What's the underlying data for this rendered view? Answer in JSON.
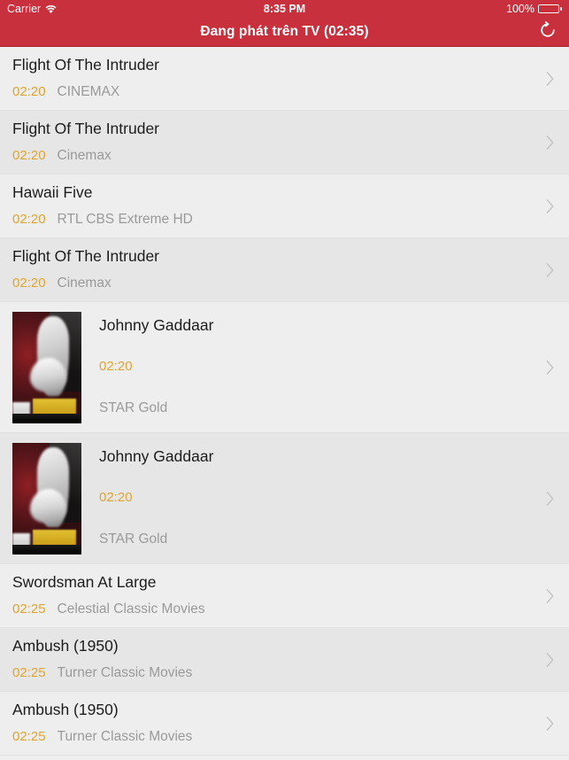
{
  "status_bar": {
    "carrier": "Carrier",
    "wifi_icon": "wifi-icon",
    "time": "8:35 PM",
    "battery_percent": "100%",
    "battery_icon": "battery-full-icon"
  },
  "nav_bar": {
    "title": "Đang phát trên TV (02:35)",
    "refresh_icon": "refresh-icon"
  },
  "colors": {
    "brand_red": "#c8303e",
    "time_amber": "#e0a430",
    "channel_gray": "#9a9a9a",
    "row_light": "#eeeeee",
    "row_dark": "#e6e6e6",
    "chevron_gray": "#c6c6c6"
  },
  "list": {
    "rows": [
      {
        "title": "Flight Of The Intruder",
        "time": "02:20",
        "channel": "CINEMAX",
        "has_thumbnail": false,
        "chevron_icon": "chevron-right-icon"
      },
      {
        "title": "Flight Of The Intruder",
        "time": "02:20",
        "channel": "Cinemax",
        "has_thumbnail": false,
        "chevron_icon": "chevron-right-icon"
      },
      {
        "title": "Hawaii Five",
        "time": "02:20",
        "channel": "RTL CBS Extreme HD",
        "has_thumbnail": false,
        "chevron_icon": "chevron-right-icon"
      },
      {
        "title": "Flight Of The Intruder",
        "time": "02:20",
        "channel": "Cinemax",
        "has_thumbnail": false,
        "chevron_icon": "chevron-right-icon"
      },
      {
        "title": "Johnny Gaddaar",
        "time": "02:20",
        "channel": "STAR Gold",
        "has_thumbnail": true,
        "thumbnail_name": "movie-poster-thumbnail",
        "chevron_icon": "chevron-right-icon"
      },
      {
        "title": "Johnny Gaddaar",
        "time": "02:20",
        "channel": "STAR Gold",
        "has_thumbnail": true,
        "thumbnail_name": "movie-poster-thumbnail",
        "chevron_icon": "chevron-right-icon"
      },
      {
        "title": "Swordsman At Large",
        "time": "02:25",
        "channel": "Celestial Classic Movies",
        "has_thumbnail": false,
        "chevron_icon": "chevron-right-icon"
      },
      {
        "title": "Ambush (1950)",
        "time": "02:25",
        "channel": "Turner Classic Movies",
        "has_thumbnail": false,
        "chevron_icon": "chevron-right-icon"
      },
      {
        "title": "Ambush (1950)",
        "time": "02:25",
        "channel": "Turner Classic Movies",
        "has_thumbnail": false,
        "chevron_icon": "chevron-right-icon"
      }
    ]
  }
}
